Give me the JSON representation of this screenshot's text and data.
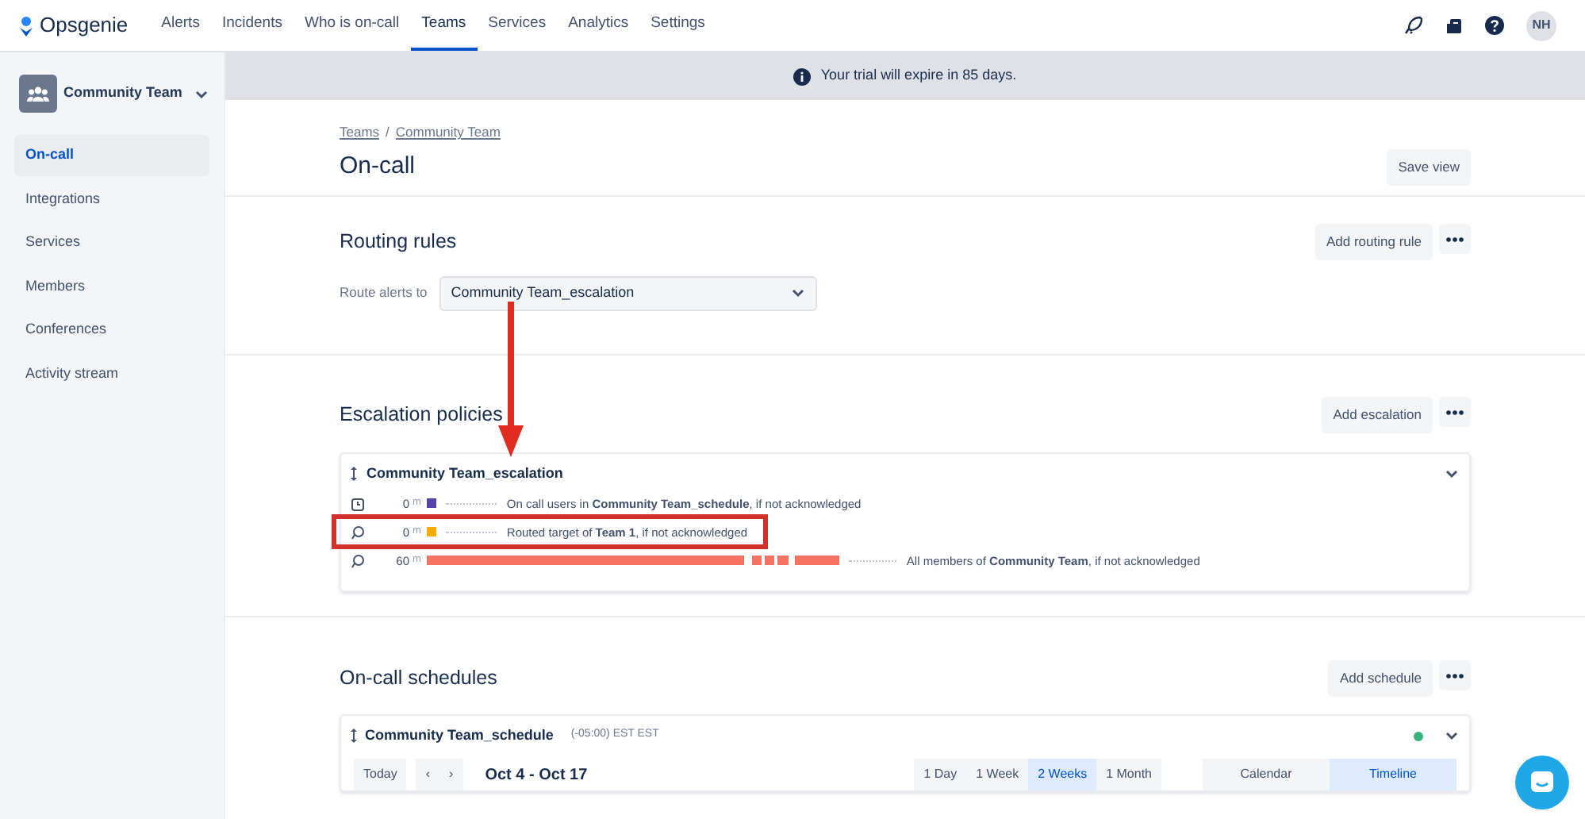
{
  "topnav": {
    "logo": "Opsgenie",
    "items": [
      {
        "label": "Alerts",
        "selected": false
      },
      {
        "label": "Incidents",
        "selected": false
      },
      {
        "label": "Who is on-call",
        "selected": false
      },
      {
        "label": "Teams",
        "selected": true
      },
      {
        "label": "Services",
        "selected": false
      },
      {
        "label": "Analytics",
        "selected": false
      },
      {
        "label": "Settings",
        "selected": false
      }
    ],
    "avatar": "NH"
  },
  "sidebar": {
    "team": "Community Team",
    "items": [
      {
        "label": "On-call",
        "selected": true
      },
      {
        "label": "Integrations",
        "selected": false
      },
      {
        "label": "Services",
        "selected": false
      },
      {
        "label": "Members",
        "selected": false
      },
      {
        "label": "Conferences",
        "selected": false
      },
      {
        "label": "Activity stream",
        "selected": false
      }
    ]
  },
  "banner": "Your trial will expire in 85 days.",
  "breadcrumb": [
    "Teams",
    "Community Team"
  ],
  "breadcrumb_separator": "/",
  "title": "On-call",
  "save_view": "Save view",
  "routing": {
    "title": "Routing rules",
    "button": "Add routing rule",
    "label": "Route alerts to",
    "value": "Community Team_escalation"
  },
  "escalation": {
    "title": "Escalation policies",
    "button": "Add escalation",
    "policy": "Community Team_escalation",
    "rows": [
      {
        "delay": "0",
        "unit": "m",
        "kind": "square",
        "color": "#5243aa",
        "text": "On call users in **Community Team_schedule**, if not acknowledged",
        "highlighted": false
      },
      {
        "delay": "0",
        "unit": "m",
        "kind": "square",
        "color": "#ffab00",
        "text": "Routed target of **Team 1**, if not acknowledged",
        "highlighted": true
      },
      {
        "delay": "60",
        "unit": "m",
        "kind": "timeline",
        "color": "#f87462",
        "text": "All members of **Community Team**, if not acknowledged",
        "highlighted": false
      }
    ]
  },
  "schedules": {
    "title": "On-call schedules",
    "button": "Add schedule",
    "schedule": "Community Team_schedule",
    "timezone": "(-05:00) EST EST",
    "toolbar": {
      "today": "Today",
      "prev": "‹",
      "next": "›",
      "range": "Oct 4 - Oct 17",
      "periods": [
        {
          "label": "1 Day",
          "selected": false
        },
        {
          "label": "1 Week",
          "selected": false
        },
        {
          "label": "2 Weeks",
          "selected": true
        },
        {
          "label": "1 Month",
          "selected": false
        }
      ],
      "views": [
        {
          "label": "Calendar",
          "selected": false
        },
        {
          "label": "Timeline",
          "selected": true
        }
      ]
    }
  }
}
